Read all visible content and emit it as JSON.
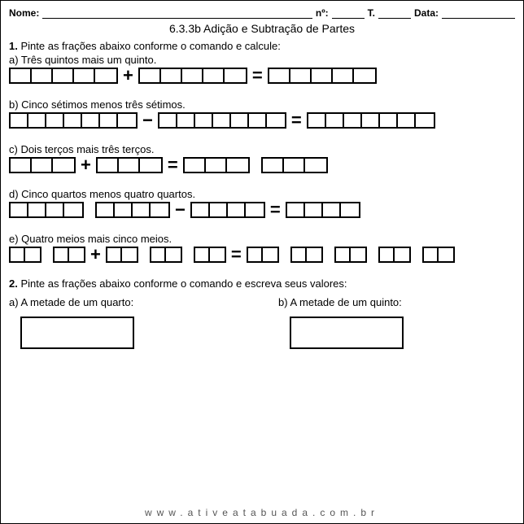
{
  "header": {
    "name_label": "Nome:",
    "num_label": "nº:",
    "t_label": "T.",
    "date_label": "Data:"
  },
  "title": "6.3.3b Adição e Subtração de Partes",
  "q1": {
    "num": "1.",
    "text": "Pinte as frações abaixo conforme o comando e calcule:",
    "a": {
      "label": "a) Três quintos mais um quinto.",
      "op1": "+",
      "op2": "=",
      "parts": 5
    },
    "b": {
      "label": "b) Cinco sétimos menos três sétimos.",
      "op1": "−",
      "op2": "=",
      "parts": 7
    },
    "c": {
      "label": "c) Dois terços mais três terços.",
      "op1": "+",
      "op2": "=",
      "parts": 3
    },
    "d": {
      "label": "d) Cinco quartos menos quatro quartos.",
      "op1": "−",
      "op2": "=",
      "parts": 4
    },
    "e": {
      "label": "e) Quatro meios mais cinco meios.",
      "op1": "+",
      "op2": "=",
      "parts": 2
    }
  },
  "q2": {
    "num": "2.",
    "text": "Pinte as frações abaixo conforme o comando e escreva seus valores:",
    "a": "a) A metade de um quarto:",
    "b": "b) A metade de um quinto:"
  },
  "footer": "www.ativeatabuada.com.br"
}
